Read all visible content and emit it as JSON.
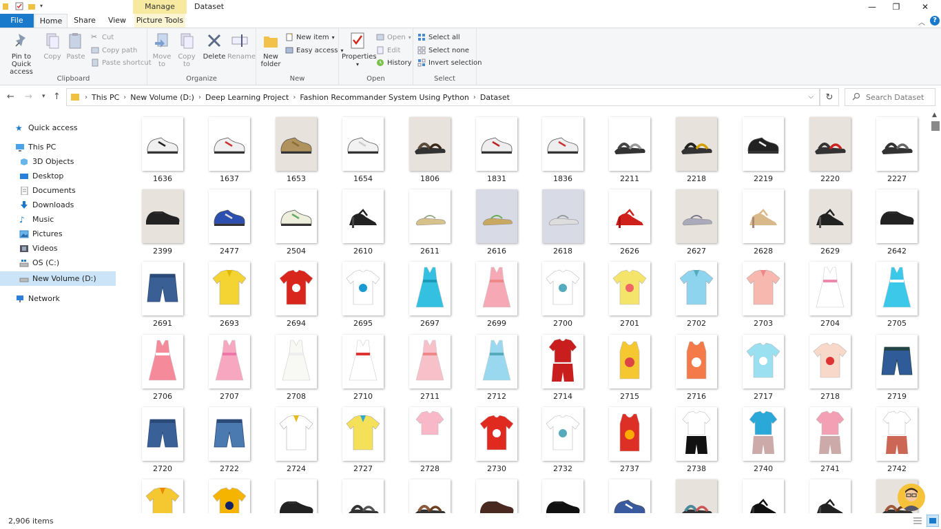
{
  "window": {
    "title": "Dataset",
    "contextual_tab": "Manage",
    "controls": {
      "minimize": "—",
      "maximize": "❐",
      "close": "✕"
    }
  },
  "tabs": {
    "file": "File",
    "home": "Home",
    "share": "Share",
    "view": "View",
    "picture_tools": "Picture Tools"
  },
  "ribbon": {
    "clipboard": {
      "label": "Clipboard",
      "pin": "Pin to Quick access",
      "copy": "Copy",
      "paste": "Paste",
      "cut": "Cut",
      "copy_path": "Copy path",
      "paste_shortcut": "Paste shortcut"
    },
    "organize": {
      "label": "Organize",
      "move_to": "Move to",
      "copy_to": "Copy to",
      "delete": "Delete",
      "rename": "Rename"
    },
    "new": {
      "label": "New",
      "new_folder": "New folder",
      "new_item": "New item",
      "easy_access": "Easy access"
    },
    "open": {
      "label": "Open",
      "properties": "Properties",
      "open": "Open",
      "edit": "Edit",
      "history": "History"
    },
    "select": {
      "label": "Select",
      "select_all": "Select all",
      "select_none": "Select none",
      "invert_selection": "Invert selection"
    }
  },
  "address": {
    "crumbs": [
      "This PC",
      "New Volume (D:)",
      "Deep Learning Project",
      "Fashion Recommander System Using Python",
      "Dataset"
    ],
    "search_placeholder": "Search Dataset"
  },
  "nav": {
    "quick_access": "Quick access",
    "this_pc": "This PC",
    "objects_3d": "3D Objects",
    "desktop": "Desktop",
    "documents": "Documents",
    "downloads": "Downloads",
    "music": "Music",
    "pictures": "Pictures",
    "videos": "Videos",
    "os_c": "OS (C:)",
    "new_volume": "New Volume (D:)",
    "network": "Network"
  },
  "files": [
    {
      "name": "1636",
      "kind": "shoe",
      "color": "#f0f0f0",
      "accent": "#222"
    },
    {
      "name": "1637",
      "kind": "shoe",
      "color": "#f0f0f0",
      "accent": "#c33"
    },
    {
      "name": "1653",
      "kind": "shoe",
      "color": "#b0925c",
      "accent": "#8a6c3a",
      "bg": 1
    },
    {
      "name": "1654",
      "kind": "shoe",
      "color": "#f2f2f2",
      "accent": "#ccc"
    },
    {
      "name": "1806",
      "kind": "sandal",
      "color": "#5a4a3a",
      "accent": "#3a2a1a",
      "bg": 1
    },
    {
      "name": "1831",
      "kind": "shoe",
      "color": "#eeeeee",
      "accent": "#b22"
    },
    {
      "name": "1836",
      "kind": "shoe",
      "color": "#eeeeee",
      "accent": "#c33"
    },
    {
      "name": "2211",
      "kind": "sandal",
      "color": "#444",
      "accent": "#999"
    },
    {
      "name": "2218",
      "kind": "sandal",
      "color": "#222",
      "accent": "#d4a000",
      "bg": 1
    },
    {
      "name": "2219",
      "kind": "shoe",
      "color": "#222",
      "accent": "#eee"
    },
    {
      "name": "2220",
      "kind": "sandal",
      "color": "#333",
      "accent": "#c22",
      "bg": 1
    },
    {
      "name": "2227",
      "kind": "sandal",
      "color": "#333",
      "accent": "#666"
    },
    {
      "name": "2399",
      "kind": "formal",
      "color": "#222",
      "accent": "#444",
      "bg": 1
    },
    {
      "name": "2477",
      "kind": "shoe",
      "color": "#2d4fb0",
      "accent": "#ddd"
    },
    {
      "name": "2504",
      "kind": "shoe",
      "color": "#eeeedd",
      "accent": "#6a6"
    },
    {
      "name": "2610",
      "kind": "heel",
      "color": "#222",
      "accent": "#444"
    },
    {
      "name": "2611",
      "kind": "flat",
      "color": "#d6c28a",
      "accent": "#9a8"
    },
    {
      "name": "2616",
      "kind": "flat",
      "color": "#c9a860",
      "accent": "#6a5",
      "bg": 2
    },
    {
      "name": "2618",
      "kind": "flat",
      "color": "#ddd",
      "accent": "#999",
      "bg": 2
    },
    {
      "name": "2626",
      "kind": "heel",
      "color": "#d0201c",
      "accent": "#a11"
    },
    {
      "name": "2627",
      "kind": "flat",
      "color": "#aab",
      "accent": "#778",
      "bg": 1
    },
    {
      "name": "2628",
      "kind": "heel",
      "color": "#d9b98a",
      "accent": "#a87"
    },
    {
      "name": "2629",
      "kind": "heel",
      "color": "#222",
      "accent": "#555",
      "bg": 1
    },
    {
      "name": "2642",
      "kind": "formal",
      "color": "#222",
      "accent": "#444"
    },
    {
      "name": "2691",
      "kind": "shorts",
      "color": "#3a5f95",
      "accent": "#2a4a7a"
    },
    {
      "name": "2693",
      "kind": "polo",
      "color": "#f3d432",
      "accent": "#e0b800"
    },
    {
      "name": "2694",
      "kind": "tshirt",
      "color": "#d8261c",
      "accent": "#fff"
    },
    {
      "name": "2695",
      "kind": "tshirt",
      "color": "#fff",
      "accent": "#1a9ad0"
    },
    {
      "name": "2697",
      "kind": "dress",
      "color": "#34c0e0",
      "accent": "#1a9ab8"
    },
    {
      "name": "2699",
      "kind": "dress",
      "color": "#f6a8b4",
      "accent": "#e88"
    },
    {
      "name": "2700",
      "kind": "tshirt",
      "color": "#fff",
      "accent": "#5ab"
    },
    {
      "name": "2701",
      "kind": "tshirt",
      "color": "#f4e46a",
      "accent": "#e66"
    },
    {
      "name": "2702",
      "kind": "polo",
      "color": "#8ed4ee",
      "accent": "#5ab"
    },
    {
      "name": "2703",
      "kind": "polo",
      "color": "#f7b8b0",
      "accent": "#e88"
    },
    {
      "name": "2704",
      "kind": "dress",
      "color": "#fff",
      "accent": "#e8a"
    },
    {
      "name": "2705",
      "kind": "dress",
      "color": "#3cc8e8",
      "accent": "#fff"
    },
    {
      "name": "2706",
      "kind": "dress",
      "color": "#f58a9a",
      "accent": "#fff"
    },
    {
      "name": "2707",
      "kind": "dress",
      "color": "#f7a8c0",
      "accent": "#e7a"
    },
    {
      "name": "2708",
      "kind": "dress",
      "color": "#f8f8f4",
      "accent": "#eee"
    },
    {
      "name": "2710",
      "kind": "dress",
      "color": "#fff",
      "accent": "#d33"
    },
    {
      "name": "2711",
      "kind": "dress",
      "color": "#f8c0c8",
      "accent": "#e88"
    },
    {
      "name": "2712",
      "kind": "dress",
      "color": "#9ad8f0",
      "accent": "#5ab"
    },
    {
      "name": "2714",
      "kind": "set",
      "color": "#c81e1e",
      "accent": "#c81e1e"
    },
    {
      "name": "2715",
      "kind": "tank",
      "color": "#f5c832",
      "accent": "#d44"
    },
    {
      "name": "2716",
      "kind": "tank",
      "color": "#f47a4a",
      "accent": "#fff"
    },
    {
      "name": "2717",
      "kind": "tshirt",
      "color": "#9ae0f0",
      "accent": "#fff"
    },
    {
      "name": "2718",
      "kind": "tshirt",
      "color": "#f8d8c8",
      "accent": "#d33"
    },
    {
      "name": "2719",
      "kind": "shorts",
      "color": "#2f5b98",
      "accent": "#244"
    },
    {
      "name": "2720",
      "kind": "shorts",
      "color": "#3a6098",
      "accent": "#2a4a7a"
    },
    {
      "name": "2722",
      "kind": "shorts",
      "color": "#4b7ab0",
      "accent": "#2a4a7a"
    },
    {
      "name": "2724",
      "kind": "polo",
      "color": "#fff",
      "accent": "#e8b820"
    },
    {
      "name": "2727",
      "kind": "polo",
      "color": "#f5e05a",
      "accent": "#3ac"
    },
    {
      "name": "2728",
      "kind": "set",
      "color": "#f8b8c8",
      "accent": "#fff"
    },
    {
      "name": "2730",
      "kind": "tshirt",
      "color": "#e02a20",
      "accent": "#fff"
    },
    {
      "name": "2732",
      "kind": "tshirt",
      "color": "#fff",
      "accent": "#5ab"
    },
    {
      "name": "2737",
      "kind": "tank",
      "color": "#dc3026",
      "accent": "#fa0"
    },
    {
      "name": "2738",
      "kind": "set",
      "color": "#fff",
      "accent": "#111"
    },
    {
      "name": "2740",
      "kind": "set",
      "color": "#2aa8d8",
      "accent": "#caa"
    },
    {
      "name": "2741",
      "kind": "set",
      "color": "#f4a0b4",
      "accent": "#caa"
    },
    {
      "name": "2742",
      "kind": "set",
      "color": "#fff",
      "accent": "#c65"
    },
    {
      "name": "",
      "kind": "polo",
      "color": "#f5c832",
      "accent": "#e80"
    },
    {
      "name": "",
      "kind": "tshirt",
      "color": "#f5b400",
      "accent": "#126"
    },
    {
      "name": "",
      "kind": "formal",
      "color": "#222",
      "accent": "#444"
    },
    {
      "name": "",
      "kind": "sandal",
      "color": "#333",
      "accent": "#555"
    },
    {
      "name": "",
      "kind": "sandal",
      "color": "#8a5a3a",
      "accent": "#6a4020"
    },
    {
      "name": "",
      "kind": "formal",
      "color": "#4a2a20",
      "accent": "#333"
    },
    {
      "name": "",
      "kind": "formal",
      "color": "#111",
      "accent": "#333"
    },
    {
      "name": "",
      "kind": "shoe",
      "color": "#3a5aa0",
      "accent": "#fff"
    },
    {
      "name": "",
      "kind": "sandal",
      "color": "#4a8a9a",
      "accent": "#c55",
      "bg": 1
    },
    {
      "name": "",
      "kind": "heel",
      "color": "#111",
      "accent": "#333"
    },
    {
      "name": "",
      "kind": "heel",
      "color": "#222",
      "accent": "#444"
    },
    {
      "name": "",
      "kind": "sandal",
      "color": "#a05a3a",
      "accent": "#704020",
      "bg": 1
    }
  ],
  "status": {
    "item_count": "2,906 items"
  }
}
